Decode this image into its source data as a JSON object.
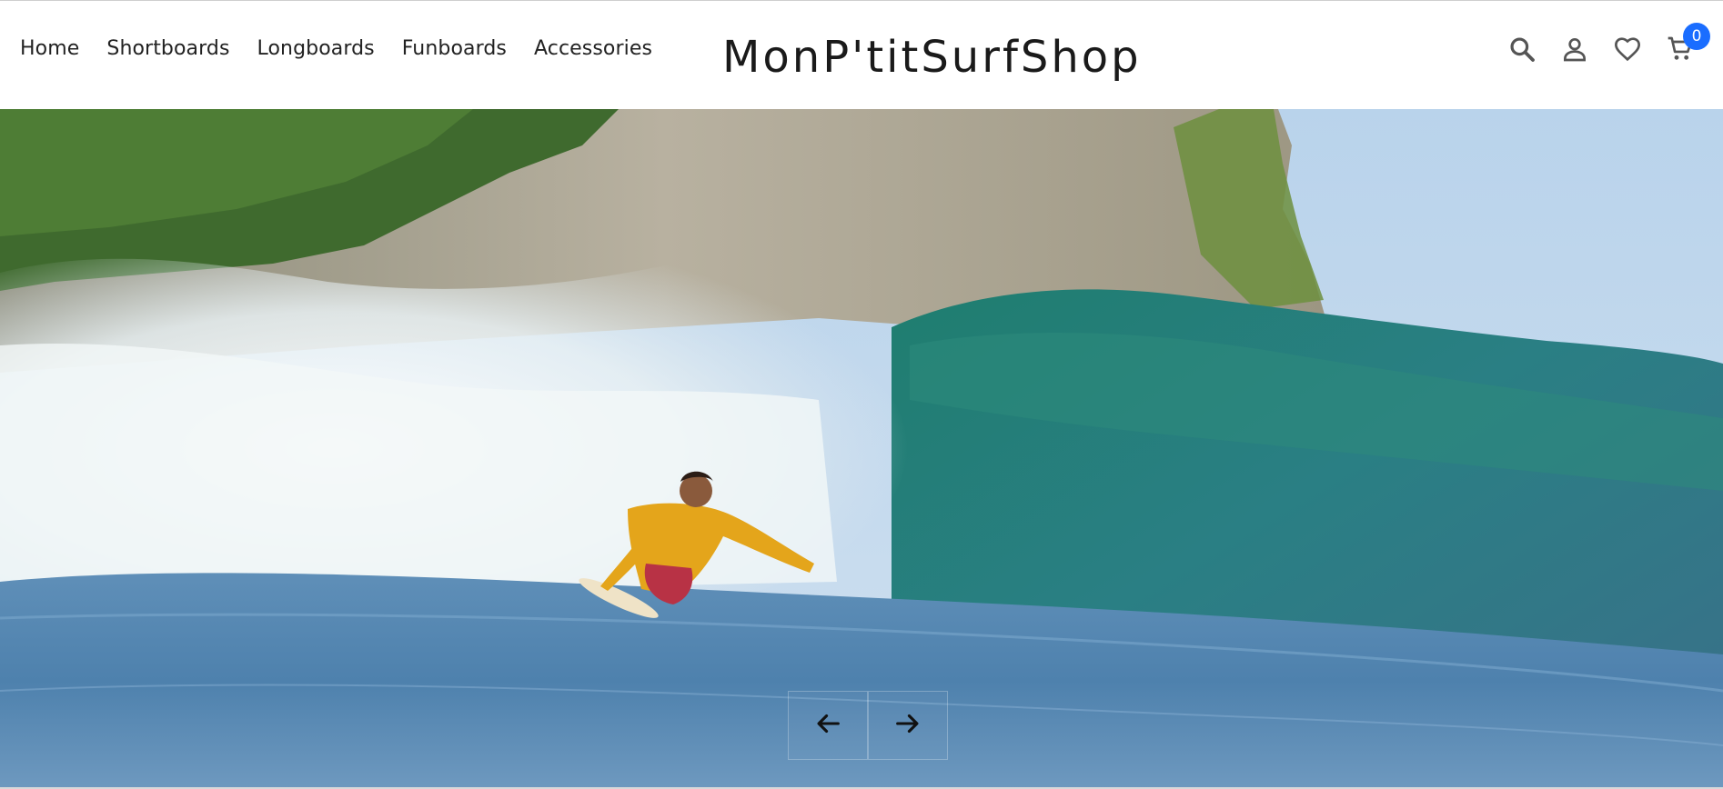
{
  "header": {
    "nav": [
      {
        "label": "Home"
      },
      {
        "label": "Shortboards"
      },
      {
        "label": "Longboards"
      },
      {
        "label": "Funboards"
      },
      {
        "label": "Accessories"
      }
    ],
    "logo": "MonP'titSurfShop",
    "cart_count": "0",
    "icons": [
      "search-icon",
      "account-icon",
      "wishlist-icon",
      "cart-icon"
    ],
    "badge_color": "#1a6dff"
  },
  "hero": {
    "controls": [
      "previous-arrow",
      "next-arrow"
    ]
  }
}
